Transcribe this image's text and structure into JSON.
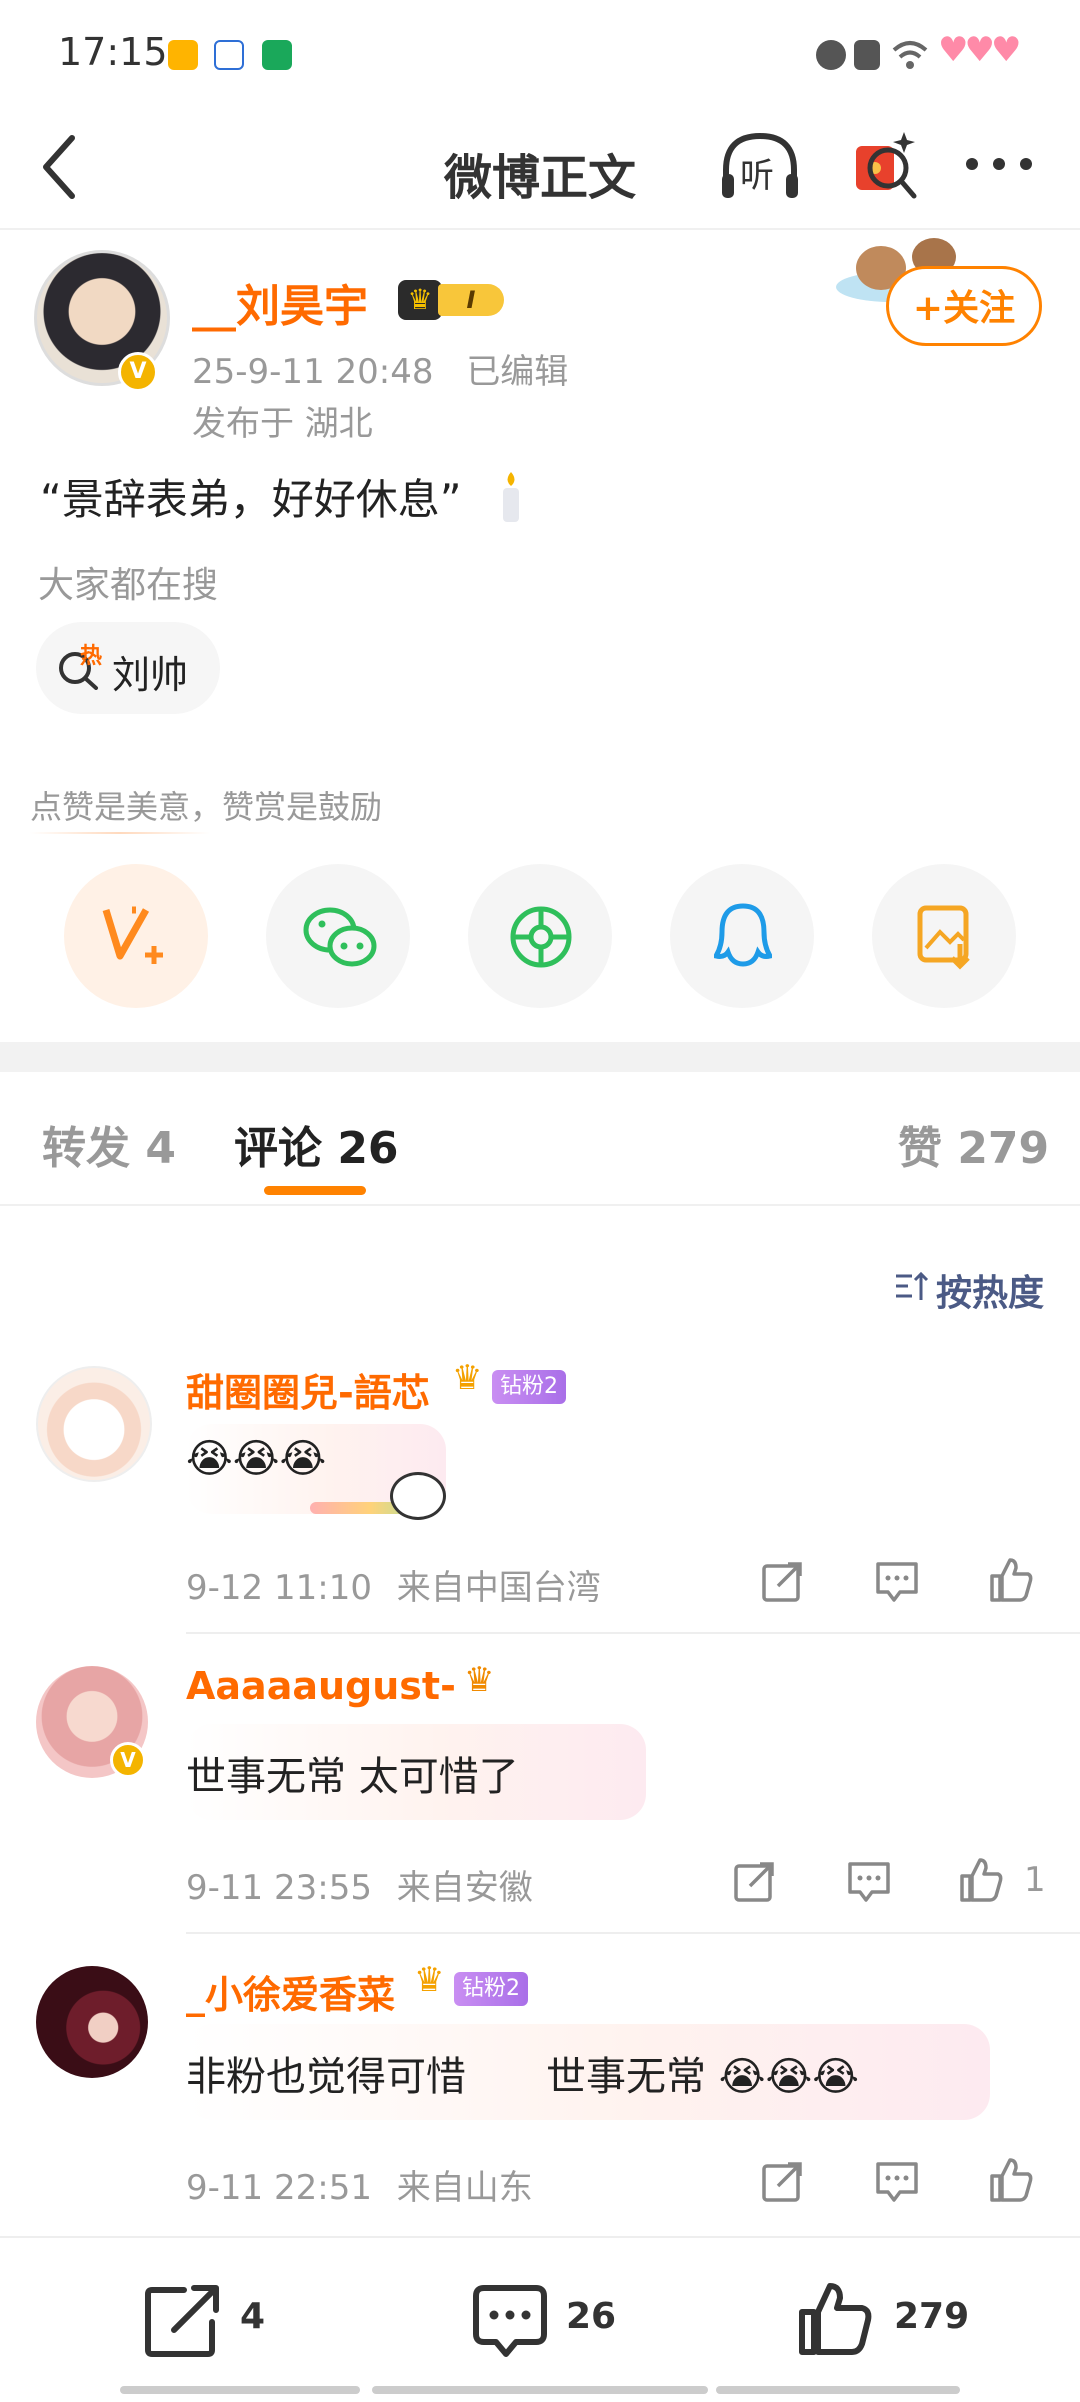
{
  "status_bar": {
    "time": "17:15",
    "app_icons": [
      "weibo-icon",
      "baidu-icon",
      "news-icon"
    ],
    "system_icons": [
      "alarm-icon",
      "close-box-icon",
      "wifi-icon",
      "heart-battery-icon"
    ]
  },
  "header": {
    "title": "微博正文",
    "listen_label": "听"
  },
  "post": {
    "author": "__刘昊宇",
    "level": "I",
    "time": "25-9-11 20:48",
    "edited": "已编辑",
    "location": "发布于 湖北",
    "follow_label": "+关注",
    "text": "“景辞表弟，好好休息”",
    "search_heading": "大家都在搜",
    "hot_tag_icon": "热",
    "hot_tag": "刘帅",
    "appreciation_text": "点赞是美意，赞赏是鼓励",
    "share_targets": [
      "reward-icon",
      "wechat-icon",
      "moments-icon",
      "qq-icon",
      "save-image-icon"
    ]
  },
  "tabs": {
    "repost": "转发 4",
    "comments": "评论 26",
    "likes": "赞 279"
  },
  "sort_label": "按热度",
  "comments": [
    {
      "name": "甜圈圈兒-語芯",
      "badge": "钻粉2",
      "text": "😭😭😭",
      "time": "9-12 11:10",
      "source": "来自中国台湾",
      "likes": ""
    },
    {
      "name": "Aaaaaugust-",
      "badge": "",
      "text": "世事无常 太可惜了",
      "time": "9-11 23:55",
      "source": "来自安徽",
      "likes": "1"
    },
    {
      "name": "_小徐爱香菜",
      "badge": "钻粉2",
      "text": "非粉也觉得可惜　　世事无常 😭😭😭",
      "time": "9-11 22:51",
      "source": "来自山东",
      "likes": ""
    }
  ],
  "bottom_bar": {
    "repost_count": "4",
    "comment_count": "26",
    "like_count": "279"
  },
  "colors": {
    "accent": "#ff8200",
    "name": "#ff6a00",
    "sort": "#4b5a85"
  }
}
